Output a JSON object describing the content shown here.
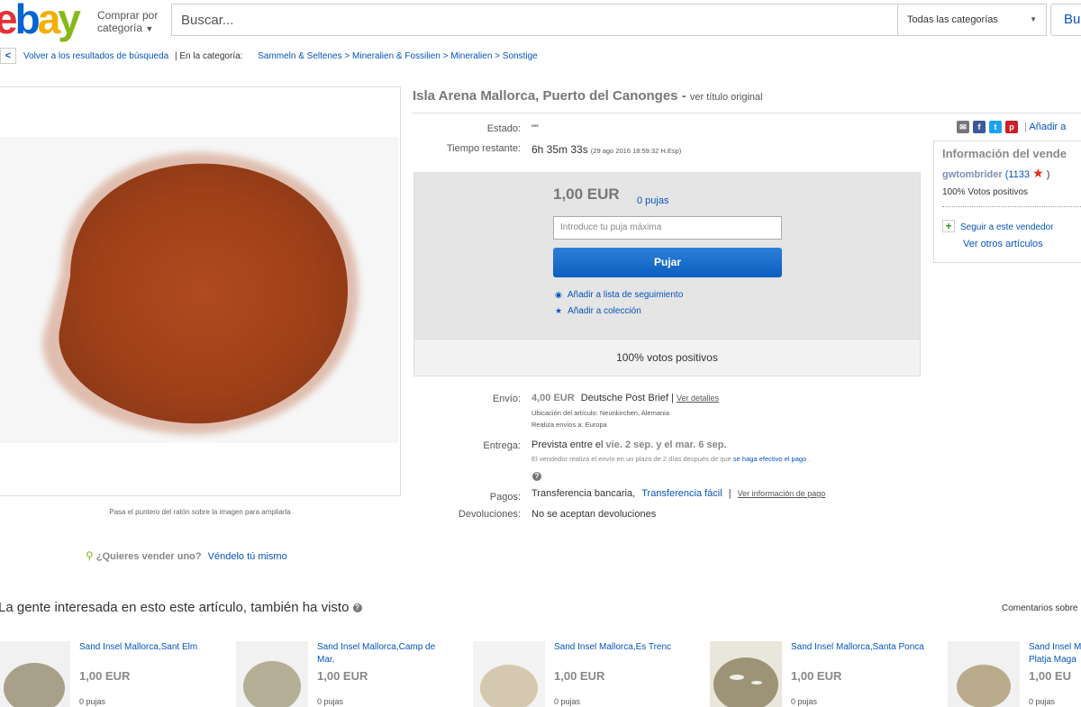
{
  "header": {
    "logo": [
      "e",
      "b",
      "a",
      "y"
    ],
    "shop_by_line1": "Comprar por",
    "shop_by_line2": "categoría",
    "search_placeholder": "Buscar...",
    "category_select": "Todas las categorías",
    "search_button": "Bu"
  },
  "breadcrumb": {
    "back": "Volver a los resultados de búsqueda",
    "in_category": "| En la categoría:",
    "path": [
      "Sammeln & Seltenes",
      "Mineralien & Fossilien",
      "Mineralien",
      "Sonstige"
    ],
    "separator": ">"
  },
  "image": {
    "hint": "Pasa el puntero del ratón sobre la imagen para ampliarla",
    "sell_question": "¿Quieres vender uno?",
    "sell_link": "Véndelo tú mismo"
  },
  "item": {
    "title": "Isla Arena Mallorca, Puerto del Canonges",
    "title_sep": "-",
    "original_title_link": "ver título original",
    "condition_label": "Estado:",
    "condition_value": "\"\"",
    "time_label": "Tiempo restante:",
    "time_value": "6h 35m 33s",
    "time_end": "(29 ago 2016  18:59:32 H.Esp)"
  },
  "bid": {
    "price": "1,00 EUR",
    "bids_link": "0 pujas",
    "input_placeholder": "Introduce tu puja máxima",
    "bid_button": "Pujar",
    "watchlist": "Añadir a lista de seguimiento",
    "collection": "Añadir a colección",
    "positive": "100% votos positivos"
  },
  "shipping": {
    "ship_label": "Envío:",
    "ship_price": "4,00 EUR",
    "ship_service": "Deutsche Post Brief",
    "ship_sep": "|",
    "ship_details": "Ver detalles",
    "location": "Ubicación del artículo:  Neunkirchen, Alemania",
    "ships_to": "Realiza envíos a:  Europa",
    "delivery_label": "Entrega:",
    "delivery_value": "Prevista entre el",
    "delivery_dates": "vie. 2 sep. y el mar. 6 sep.",
    "delivery_note": "El vendedor realiza el envío en un plazo de 2 días después de que",
    "delivery_note_link": "se haga efectivo el pago",
    "delivery_note_end": ".",
    "payments_label": "Pagos:",
    "payments_value": "Transferencia bancaria,",
    "payments_link": "Transferencia fácil",
    "payments_sep": "|",
    "payments_info": "Ver información de pago",
    "returns_label": "Devoluciones:",
    "returns_value": "No se aceptan devoluciones"
  },
  "seller": {
    "share_icons": [
      "mail-icon",
      "facebook-icon",
      "twitter-icon",
      "pinterest-icon"
    ],
    "share_f": "f",
    "share_t": "t",
    "share_p": "p",
    "share_mail": "✉",
    "add_to": "Añadir a",
    "title": "Información del vende",
    "name": "gwtombrider",
    "feedback": "(1133",
    "feedback_end": ")",
    "star": "★",
    "positive": "100% Votos positivos",
    "follow": "Seguir a este vendedor",
    "other_items": "Ver otros artículos"
  },
  "related": {
    "heading": "La gente interesada en esto este artículo, también ha visto",
    "comments": "Comentarios sobre",
    "items": [
      {
        "title": "Sand Insel Mallorca,Sant Elm",
        "price": "1,00 EUR",
        "bids": "0 pujas"
      },
      {
        "title": "Sand Insel Mallorca,Camp de Mar,",
        "price": "1,00 EUR",
        "bids": "0 pujas"
      },
      {
        "title": "Sand Insel Mallorca,Es Trenc",
        "price": "1,00 EUR",
        "bids": "0 pujas"
      },
      {
        "title": "Sand Insel Mallorca,Santa Ponca",
        "price": "1,00 EUR",
        "bids": "0 pujas"
      },
      {
        "title": "Sand Insel M Platja Maga",
        "price": "1,00 EU",
        "bids": "0 pujas"
      }
    ]
  },
  "colors": {
    "link": "#0654ba",
    "bid_button": "#0c5fbf",
    "sand_main": "#a5441b",
    "star": "#e42e18"
  }
}
